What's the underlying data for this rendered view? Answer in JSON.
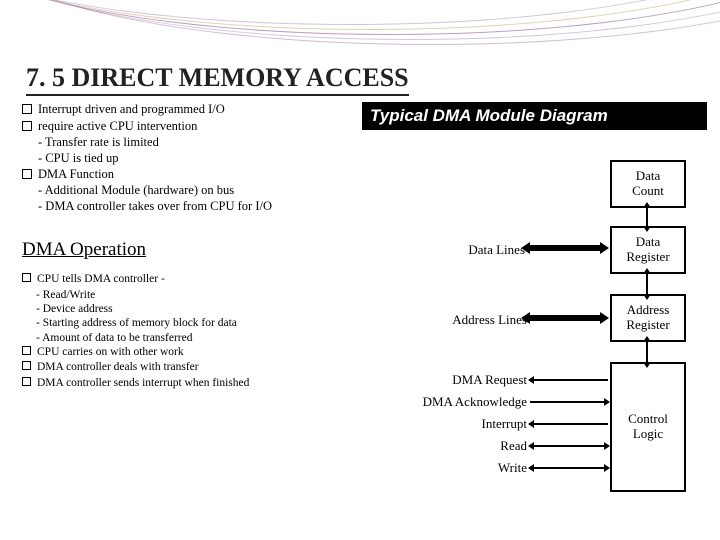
{
  "title": "7. 5  DIRECT MEMORY ACCESS",
  "section1": {
    "b1": "Interrupt driven and programmed I/O",
    "b2": "require active CPU intervention",
    "b2s1": "- Transfer rate is limited",
    "b2s2": "- CPU is tied up",
    "b3": "DMA Function",
    "b3s1": "- Additional Module (hardware) on bus",
    "b3s2": "- DMA controller takes over from CPU for I/O"
  },
  "subheading": "DMA Operation",
  "section2": {
    "b1": "CPU tells DMA controller -",
    "b1s1": "- Read/Write",
    "b1s2": "- Device address",
    "b1s3": "- Starting address of memory block for data",
    "b1s4": "- Amount of data to be transferred",
    "b2": "CPU carries on with other work",
    "b3": "DMA controller deals with transfer",
    "b4": "DMA controller sends interrupt when finished"
  },
  "diagram": {
    "title": "Typical DMA Module Diagram",
    "boxes": {
      "data_count": "Data\nCount",
      "data_reg": "Data\nRegister",
      "addr_reg": "Address\nRegister",
      "ctrl_logic": "Control\nLogic"
    },
    "labels": {
      "data_lines": "Data Lines",
      "addr_lines": "Address Lines",
      "dma_req": "DMA Request",
      "dma_ack": "DMA Acknowledge",
      "interrupt": "Interrupt",
      "read": "Read",
      "write": "Write"
    }
  }
}
